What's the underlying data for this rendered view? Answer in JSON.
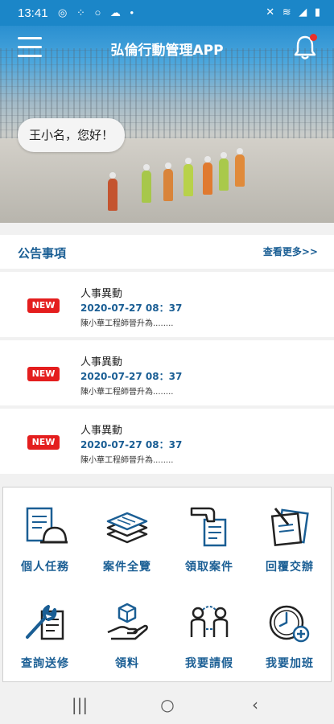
{
  "status_bar": {
    "time": "13:41",
    "left_icons": "◎ ⁘ ○ ☁ •",
    "right_icons": "✕ ≋ ◢ ▮"
  },
  "header": {
    "title": "弘倫行動管理APP",
    "menu_icon": "hamburger-menu-icon",
    "notification_icon": "bell-icon",
    "notification_dot_color": "#e8302b"
  },
  "greeting": "王小名，您好！",
  "announcements": {
    "title": "公告事項",
    "more_label": "查看更多>>",
    "items": [
      {
        "badge": "NEW",
        "subject": "人事異動",
        "date": "2020-07-27 08：37",
        "desc": "陳小華工程師晉升為........"
      },
      {
        "badge": "NEW",
        "subject": "人事異動",
        "date": "2020-07-27 08：37",
        "desc": "陳小華工程師晉升為........"
      },
      {
        "badge": "NEW",
        "subject": "人事異動",
        "date": "2020-07-27 08：37",
        "desc": "陳小華工程師晉升為........"
      }
    ]
  },
  "functions": [
    {
      "label": "個人任務",
      "icon": "document-hardhat-icon"
    },
    {
      "label": "案件全覽",
      "icon": "stacked-documents-icon"
    },
    {
      "label": "領取案件",
      "icon": "hand-document-icon"
    },
    {
      "label": "回覆交辦",
      "icon": "document-pen-icon"
    },
    {
      "label": "查詢送修",
      "icon": "wrench-document-icon"
    },
    {
      "label": "領料",
      "icon": "hand-box-icon"
    },
    {
      "label": "我要請假",
      "icon": "people-swap-icon"
    },
    {
      "label": "我要加班",
      "icon": "clock-plus-icon"
    }
  ],
  "navbar": {
    "recent": "|||",
    "home": "○",
    "back": "‹"
  },
  "colors": {
    "primary": "#1a5e94",
    "status_bar": "#1b86c8",
    "badge": "#e41e1e"
  }
}
